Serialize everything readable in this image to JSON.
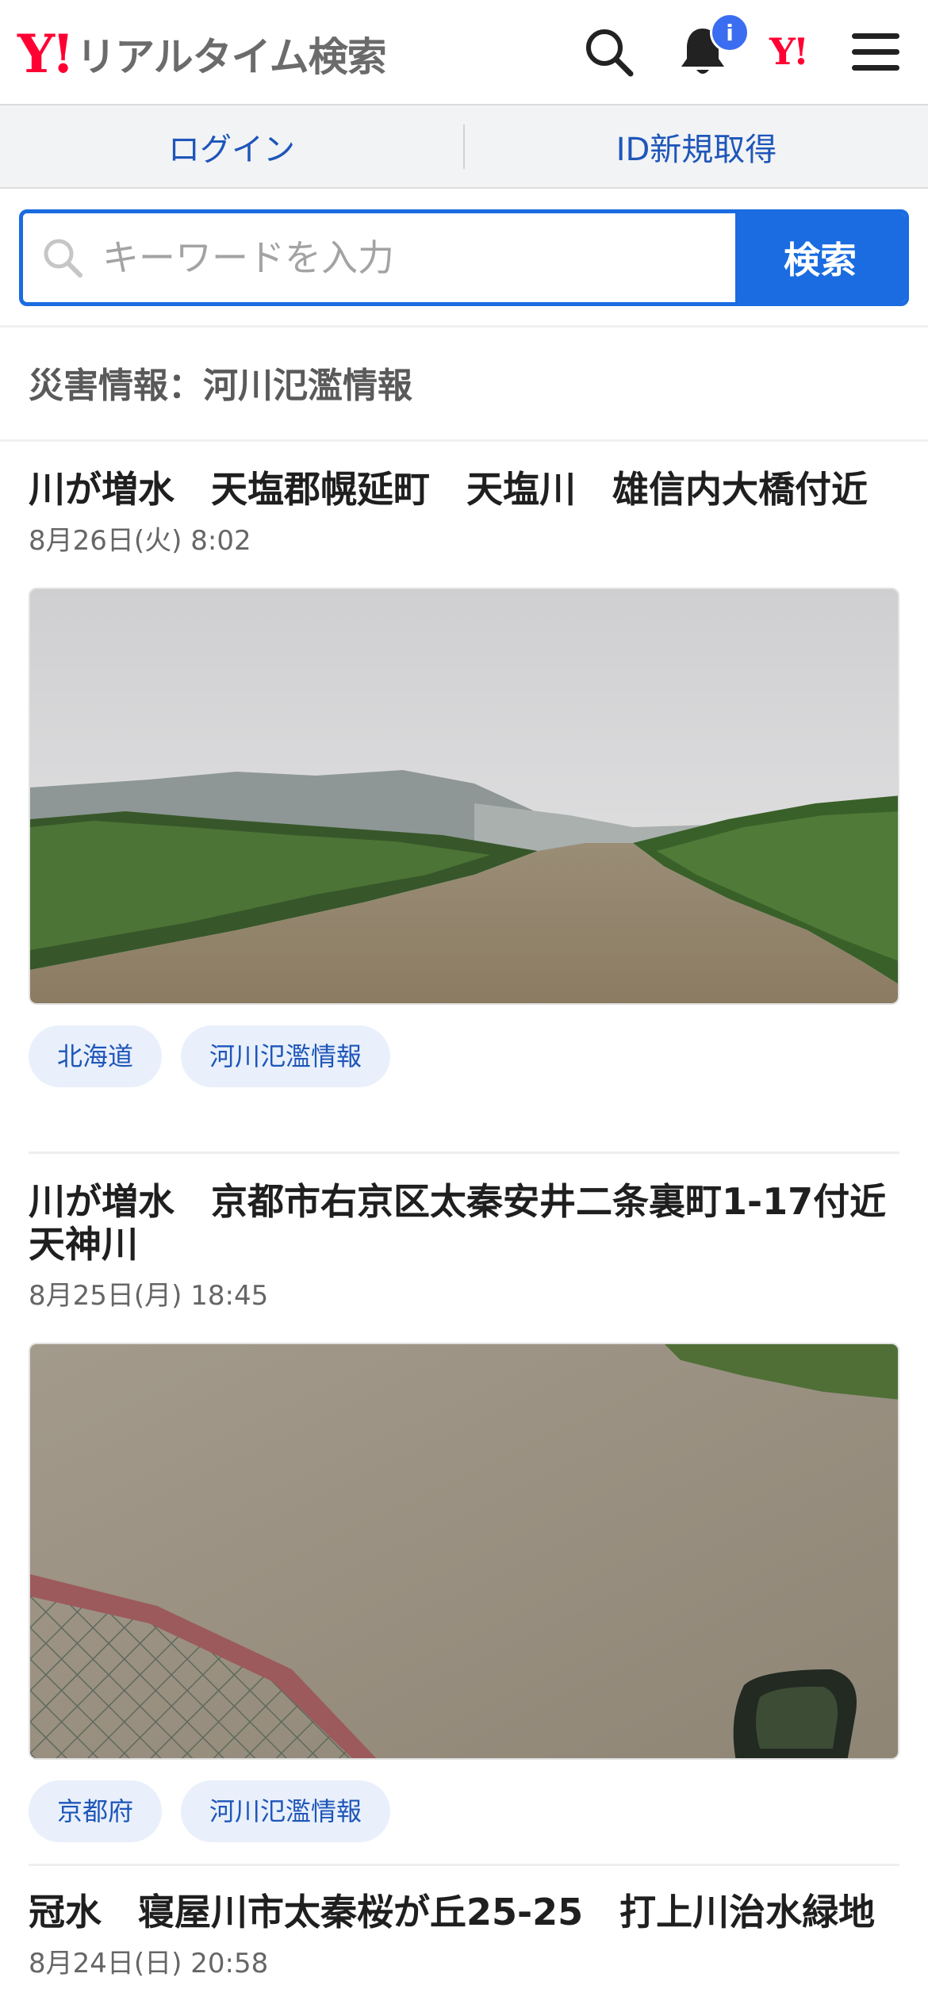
{
  "header": {
    "logo_mark": "Y!",
    "logo_text": "リアルタイム検索",
    "notification_badge": "i",
    "yahoo_small_logo": "Y!"
  },
  "account_bar": {
    "login_label": "ログイン",
    "register_label": "ID新規取得"
  },
  "search": {
    "placeholder": "キーワードを入力",
    "button_label": "検索"
  },
  "category_title": "災害情報：河川氾濫情報",
  "articles": [
    {
      "title": "川が増水　天塩郡幌延町　天塩川　雄信内大橋付近",
      "date": "8月26日(火) 8:02",
      "tags": [
        "北海道",
        "河川氾濫情報"
      ]
    },
    {
      "title": "川が増水　京都市右京区太秦安井二条裏町1-17付近　天神川",
      "date": "8月25日(月) 18:45",
      "tags": [
        "京都府",
        "河川氾濫情報"
      ]
    },
    {
      "title": "冠水　寝屋川市太秦桜が丘25-25　打上川治水緑地",
      "date": "8月24日(日) 20:58"
    }
  ],
  "colors": {
    "accent_blue": "#1a6ce0",
    "link_blue": "#1e56b9",
    "yahoo_red": "#ff0033",
    "tag_bg": "#e9f0fb"
  }
}
